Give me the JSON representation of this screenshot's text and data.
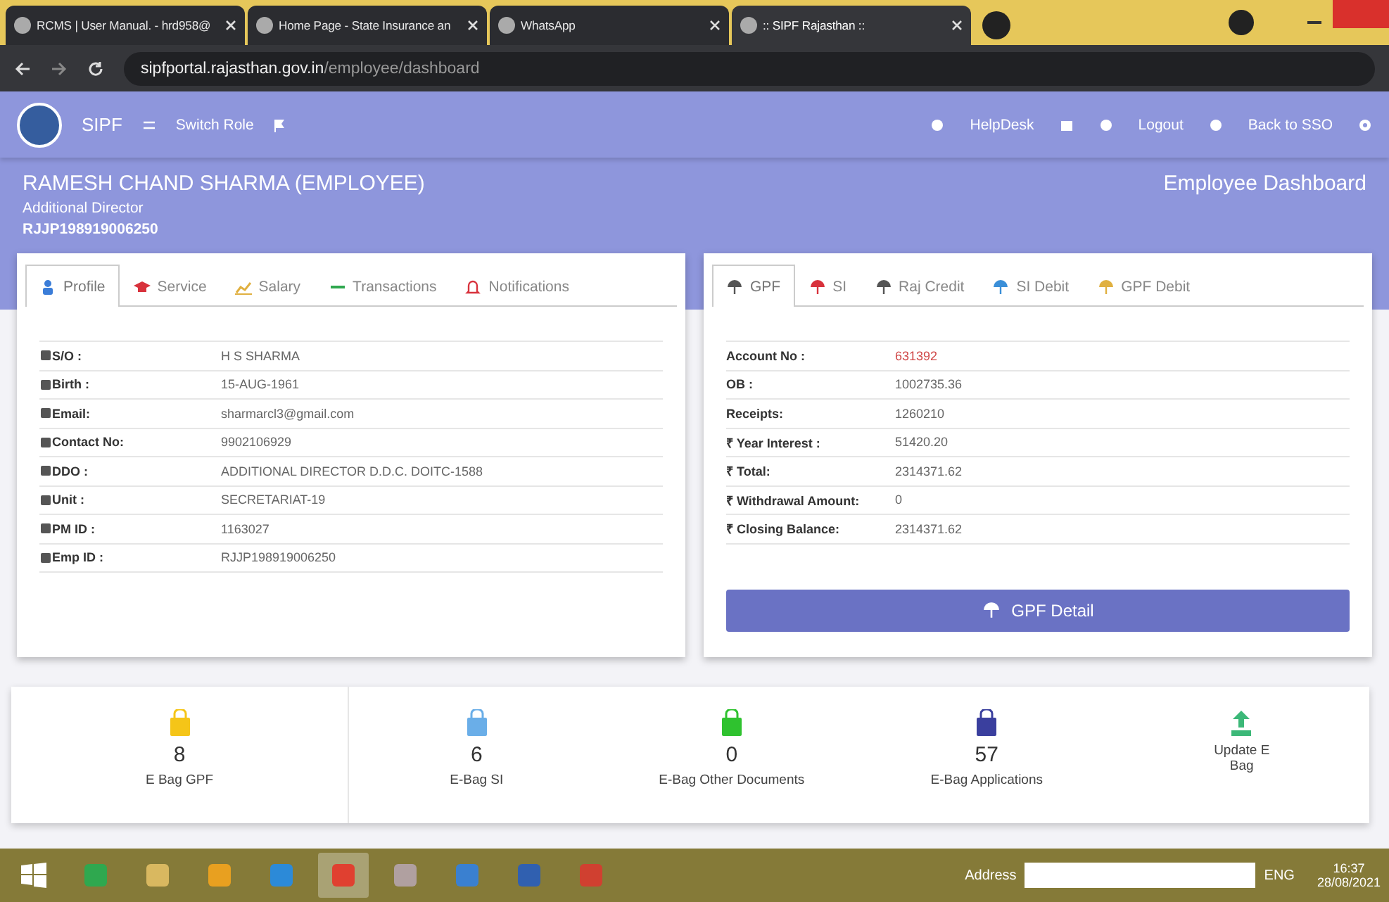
{
  "browser": {
    "tabs": [
      {
        "title": "RCMS | User Manual. - hrd958@",
        "selected": false
      },
      {
        "title": "Home Page - State Insurance an",
        "selected": false
      },
      {
        "title": "WhatsApp",
        "selected": false
      },
      {
        "title": ":: SIPF Rajasthan ::",
        "selected": true
      }
    ],
    "address": {
      "host": "sipfportal.rajasthan.gov.in",
      "path": "/employee/dashboard"
    }
  },
  "nav": {
    "brand": "SIPF",
    "switch_role": "Switch Role",
    "right": [
      "HelpDesk",
      "Logout",
      "Back to SSO"
    ]
  },
  "header": {
    "name": "RAMESH CHAND SHARMA (EMPLOYEE)",
    "designation": "Additional Director",
    "employee_id": "RJJP198919006250",
    "title": "Employee Dashboard"
  },
  "profile_card": {
    "tabs": [
      {
        "label": "Profile",
        "selected": true,
        "color": "#3b7dd8"
      },
      {
        "label": "Service",
        "selected": false,
        "color": "#d8323c"
      },
      {
        "label": "Salary",
        "selected": false,
        "color": "#e0b040"
      },
      {
        "label": "Transactions",
        "selected": false,
        "color": "#2fa84f"
      },
      {
        "label": "Notifications",
        "selected": false,
        "color": "#d8323c"
      }
    ],
    "rows": [
      {
        "label": "S/O :",
        "value": "H S SHARMA"
      },
      {
        "label": "Birth :",
        "value": "15-AUG-1961"
      },
      {
        "label": "Email:",
        "value": "sharmarcl3@gmail.com"
      },
      {
        "label": "Contact No:",
        "value": "9902106929"
      },
      {
        "label": "DDO :",
        "value": "ADDITIONAL DIRECTOR D.D.C. DOITC-1588"
      },
      {
        "label": "Unit :",
        "value": "SECRETARIAT-19"
      },
      {
        "label": "PM ID :",
        "value": "1163027"
      },
      {
        "label": "Emp ID :",
        "value": "RJJP198919006250"
      }
    ]
  },
  "gpf_card": {
    "tabs": [
      {
        "label": "GPF",
        "selected": true,
        "color": "#555555"
      },
      {
        "label": "SI",
        "selected": false,
        "color": "#d8323c"
      },
      {
        "label": "Raj Credit",
        "selected": false,
        "color": "#555555"
      },
      {
        "label": "SI Debit",
        "selected": false,
        "color": "#3b8fd8"
      },
      {
        "label": "GPF Debit",
        "selected": false,
        "color": "#e0b040"
      }
    ],
    "rows": [
      {
        "label": "Account No :",
        "value": "631392",
        "highlight": true
      },
      {
        "label": "OB :",
        "value": "1002735.36",
        "highlight": false
      },
      {
        "label": "Receipts:",
        "value": "1260210",
        "highlight": false
      },
      {
        "label": "₹ Year Interest :",
        "value": "51420.20",
        "highlight": false
      },
      {
        "label": "₹ Total:",
        "value": "2314371.62",
        "highlight": false
      },
      {
        "label": "₹ Withdrawal Amount:",
        "value": "0",
        "highlight": false
      },
      {
        "label": "₹ Closing Balance:",
        "value": "2314371.62",
        "highlight": false
      }
    ],
    "button": "GPF Detail"
  },
  "ebags": [
    {
      "kind": "bag",
      "color": "#f5c518",
      "count": "8",
      "label": "E Bag GPF"
    },
    {
      "kind": "bag",
      "color": "#6aaee8",
      "count": "6",
      "label": "E-Bag SI"
    },
    {
      "kind": "bag",
      "color": "#2fc22f",
      "count": "0",
      "label": "E-Bag Other Documents"
    },
    {
      "kind": "bag",
      "color": "#3a3f9e",
      "count": "57",
      "label": "E-Bag Applications"
    },
    {
      "kind": "upload",
      "color": "#3cb878",
      "label": "Update E Bag"
    }
  ],
  "taskbar": {
    "address_label": "Address",
    "language": "ENG",
    "time": "16:37",
    "date": "28/08/2021"
  }
}
